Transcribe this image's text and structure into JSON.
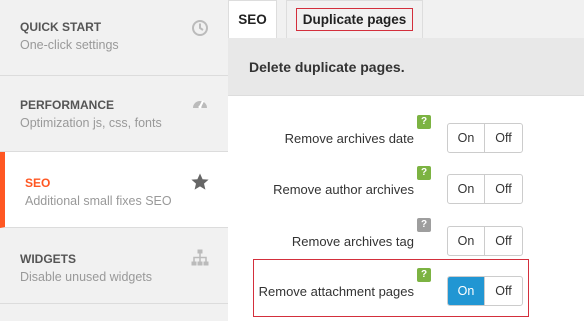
{
  "sidebar": {
    "items": [
      {
        "title": "QUICK START",
        "subtitle": "One-click settings",
        "icon": "clock-icon"
      },
      {
        "title": "PERFORMANCE",
        "subtitle": "Optimization js, css, fonts",
        "icon": "speedometer-icon"
      },
      {
        "title": "SEO",
        "subtitle": "Additional small fixes SEO",
        "icon": "star-icon"
      },
      {
        "title": "WIDGETS",
        "subtitle": "Disable unused widgets",
        "icon": "sitemap-icon"
      }
    ]
  },
  "tabs": [
    {
      "label": "SEO"
    },
    {
      "label": "Duplicate pages"
    }
  ],
  "section_heading": "Delete duplicate pages.",
  "rows": [
    {
      "label": "Remove archives date",
      "help": "?",
      "on": "On",
      "off": "Off",
      "state": "off"
    },
    {
      "label": "Remove author archives",
      "help": "?",
      "on": "On",
      "off": "Off",
      "state": "off"
    },
    {
      "label": "Remove archives tag",
      "help": "?",
      "on": "On",
      "off": "Off",
      "state": "off"
    },
    {
      "label": "Remove attachment pages",
      "help": "?",
      "on": "On",
      "off": "Off",
      "state": "on"
    }
  ],
  "colors": {
    "accent": "#ff5722",
    "toggle_active": "#2196d3",
    "help_green": "#7cb342",
    "help_grey": "#9e9e9e",
    "highlight_red": "#d32f3c"
  }
}
